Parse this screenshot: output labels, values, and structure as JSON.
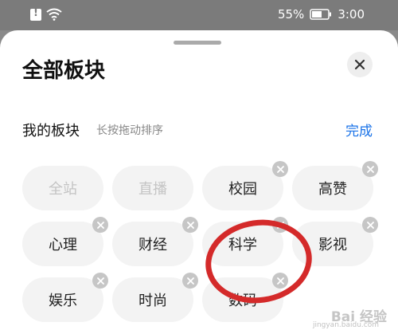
{
  "status_bar": {
    "battery_percent": "55%",
    "time": "3:00"
  },
  "sheet": {
    "title": "全部板块"
  },
  "my_sections": {
    "label": "我的板块",
    "hint": "长按拖动排序",
    "done_label": "完成"
  },
  "chips": [
    {
      "label": "全站",
      "removable": false
    },
    {
      "label": "直播",
      "removable": false
    },
    {
      "label": "校园",
      "removable": true
    },
    {
      "label": "高赞",
      "removable": true
    },
    {
      "label": "心理",
      "removable": true
    },
    {
      "label": "财经",
      "removable": true
    },
    {
      "label": "科学",
      "removable": true
    },
    {
      "label": "影视",
      "removable": true
    },
    {
      "label": "娱乐",
      "removable": true
    },
    {
      "label": "时尚",
      "removable": true
    },
    {
      "label": "数码",
      "removable": true
    }
  ],
  "watermark": {
    "text": "Bai 经验",
    "sub": "jingyan.baidu.com"
  },
  "colors": {
    "accent": "#1a73e8",
    "annotation": "#d42a2a"
  }
}
